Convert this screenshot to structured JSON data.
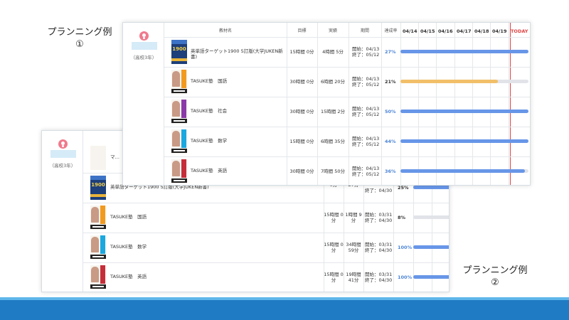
{
  "labels": {
    "example_1_line1": "プランニング例",
    "example_1_line2": "①",
    "example_2_line1": "プランニング例",
    "example_2_line2": "②"
  },
  "colors": {
    "bottom_bar": "#1f7cc4",
    "accent": "#5eb6ea",
    "bar_blue": "#6796e8",
    "bar_orange": "#f2bf69",
    "today": "#e04444"
  },
  "front": {
    "student_grade": "（高校3年）",
    "headers": {
      "material": "教材名",
      "target": "目標",
      "actual": "実績",
      "period": "期間",
      "rate": "達成率"
    },
    "days": [
      "04/14",
      "04/15",
      "04/16",
      "04/17",
      "04/18",
      "04/19",
      "TODAY"
    ],
    "rows": [
      {
        "name": "英単語ターゲット1900 5訂版(大学JUKEN新書)",
        "book_num": "1900",
        "target": "15時間 0分",
        "actual": "4時間 5分",
        "start": "開始：04/13",
        "end": "終了：05/12",
        "rate": "27%",
        "progress": 1.0,
        "bar": "blue",
        "spine": "#1d3f7a"
      },
      {
        "name": "TASUKE塾　国語",
        "target": "30時間 0分",
        "actual": "6時間 20分",
        "start": "開始：04/13",
        "end": "終了：05/12",
        "rate": "21%",
        "progress": 0.76,
        "bar": "orange",
        "spine": "#f29a1f"
      },
      {
        "name": "TASUKE塾　社会",
        "target": "30時間 0分",
        "actual": "15時間 2分",
        "start": "開始：04/13",
        "end": "終了：05/12",
        "rate": "50%",
        "progress": 1.0,
        "bar": "blue",
        "spine": "#8a3aa8"
      },
      {
        "name": "TASUKE塾　数学",
        "target": "15時間 0分",
        "actual": "6時間 35分",
        "start": "開始：04/13",
        "end": "終了：05/12",
        "rate": "44%",
        "progress": 1.0,
        "bar": "blue",
        "spine": "#1aa8e0"
      },
      {
        "name": "TASUKE塾　英語",
        "target": "30時間 0分",
        "actual": "7時間 50分",
        "start": "開始：04/13",
        "end": "終了：05/12",
        "rate": "36%",
        "progress": 0.97,
        "bar": "blue",
        "spine": "#c62d3a"
      }
    ]
  },
  "back": {
    "student_grade": "（高校3年）",
    "rows": [
      {
        "name": "マ…",
        "partial": true
      },
      {
        "name": "英単語ターゲット1900 5訂版(大学JUKEN新書)",
        "book_num": "1900",
        "target": "0分",
        "actual": "27分",
        "start": "",
        "end": "終了：04/30",
        "rate": "25%",
        "progress": 1.0,
        "bar": "blue",
        "spine": "#1d3f7a"
      },
      {
        "name": "TASUKE塾　国語",
        "target": "15時間 0分",
        "actual": "1時間 9分",
        "start": "開始：03/31",
        "end": "終了：04/30",
        "rate": "8%",
        "progress": 0.0,
        "bar": "blue",
        "spine": "#f29a1f"
      },
      {
        "name": "TASUKE塾　数学",
        "target": "15時間 0分",
        "actual": "34時間 59分",
        "start": "開始：03/31",
        "end": "終了：04/30",
        "rate": "100%",
        "progress": 1.0,
        "bar": "blue",
        "spine": "#1aa8e0"
      },
      {
        "name": "TASUKE塾　英語",
        "target": "15時間 0分",
        "actual": "19時間 41分",
        "start": "開始：03/31",
        "end": "終了：04/30",
        "rate": "100%",
        "progress": 1.0,
        "bar": "blue",
        "spine": "#c62d3a"
      }
    ]
  }
}
